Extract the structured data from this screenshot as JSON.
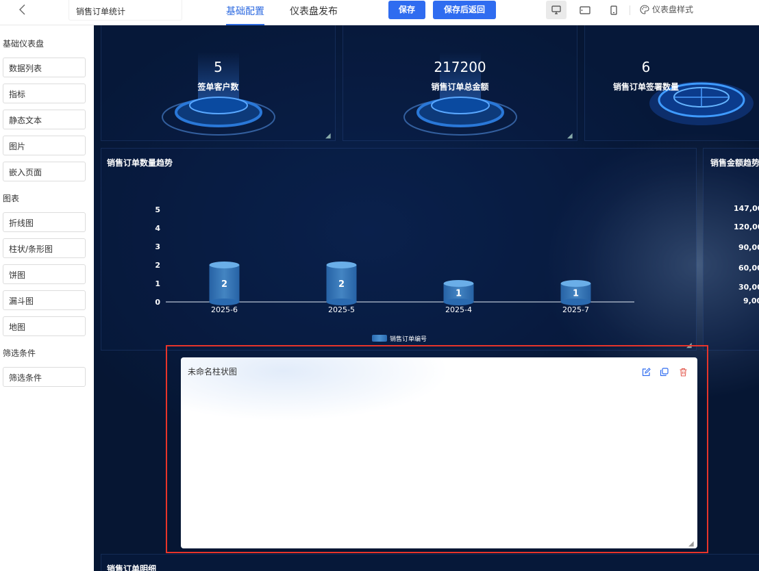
{
  "topbar": {
    "dashboard_name": "销售订单统计",
    "tabs": [
      {
        "label": "基础配置",
        "active": true
      },
      {
        "label": "仪表盘发布",
        "active": false
      }
    ],
    "save_label": "保存",
    "save_return_label": "保存后返回",
    "style_label": "仪表盘样式",
    "accent_color": "#2f6cf0"
  },
  "sidebar": {
    "groups": [
      {
        "heading": "基础仪表盘",
        "items": [
          "数据列表",
          "指标",
          "静态文本",
          "图片",
          "嵌入页面"
        ]
      },
      {
        "heading": "图表",
        "items": [
          "折线图",
          "柱状/条形图",
          "饼图",
          "漏斗图",
          "地图"
        ]
      },
      {
        "heading": "筛选条件",
        "items": [
          "筛选条件"
        ]
      }
    ]
  },
  "kpis": [
    {
      "value": "5",
      "label": "签单客户数"
    },
    {
      "value": "217200",
      "label": "销售订单总金额"
    },
    {
      "value": "6",
      "label": "销售订单签署数量"
    }
  ],
  "charts": {
    "order_trend_title": "销售订单数量趋势",
    "amount_trend_title": "销售金额趋势",
    "amount_axis_ticks": [
      "147,00",
      "120,00",
      "90,00",
      "60,00",
      "30,00",
      "9,00"
    ],
    "detail_title": "销售订单明细"
  },
  "chart_data": {
    "type": "bar",
    "title": "销售订单数量趋势",
    "categories": [
      "2025-6",
      "2025-5",
      "2025-4",
      "2025-7"
    ],
    "series": [
      {
        "name": "销售订单编号",
        "values": [
          2,
          2,
          1,
          1
        ]
      }
    ],
    "ylim": [
      0,
      5
    ],
    "yticks": [
      0,
      1,
      2,
      3,
      4,
      5
    ],
    "legend": "bottom-center",
    "grid": false
  },
  "selected_widget": {
    "title": "未命名柱状图",
    "actions": [
      "edit-icon",
      "copy-icon",
      "delete-icon"
    ],
    "highlight_color": "#e8342a"
  }
}
